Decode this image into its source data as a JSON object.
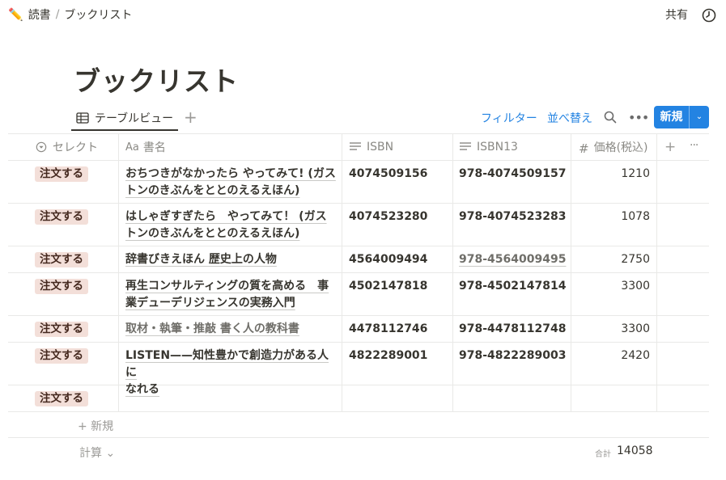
{
  "breadcrumb": {
    "icon": "pencil-icon",
    "parent": "読書",
    "separator": "/",
    "current": "ブックリスト"
  },
  "topbar": {
    "share_label": "共有",
    "history_icon": "clock-icon"
  },
  "page": {
    "title": "ブックリスト"
  },
  "view": {
    "tab_label": "テーブルビュー",
    "add_view_label": "+",
    "filter_label": "フィルター",
    "sort_label": "並べ替え",
    "new_label": "新規",
    "new_arrow": "⌄"
  },
  "columns": [
    {
      "label": "セレクト",
      "icon": "select-icon"
    },
    {
      "label": "書名",
      "icon": "title-aa-icon"
    },
    {
      "label": "ISBN",
      "icon": "text-lines-icon"
    },
    {
      "label": "ISBN13",
      "icon": "text-lines-icon"
    },
    {
      "label": "価格(税込)",
      "icon": "number-hash-icon"
    }
  ],
  "header_add": "+",
  "header_more": "···",
  "rows": [
    {
      "select": "注文する",
      "title": "おちつきがなかったら やってみて! (ガストンのきぶんをととのえるえほん)",
      "title_line1": "おちつきがなかったら やってみて! (ガス",
      "title_line2": "トンのきぶんをととのえるえほん)",
      "isbn": "4074509156",
      "isbn13": "978-4074509157",
      "price": "1210"
    },
    {
      "select": "注文する",
      "title": "はしゃぎすぎたら　やってみて！ (ガストンのきぶんをととのえるえほん)",
      "title_line1": "はしゃぎすぎたら　やってみて！ (ガス",
      "title_line2": "トンのきぶんをととのえるえほん)",
      "isbn": "4074523280",
      "isbn13": "978-4074523283",
      "price": "1078"
    },
    {
      "select": "注文する",
      "title": "辞書びきえほん 歴史上の人物",
      "title_line1": "辞書びきえほん 歴史上の人物",
      "title_line2": "",
      "isbn": "4564009494",
      "isbn13": "978-4564009495",
      "price": "2750"
    },
    {
      "select": "注文する",
      "title": "再生コンサルティングの質を高める　事業デューデリジェンスの実務入門",
      "title_line1": "再生コンサルティングの質を高める　事",
      "title_line2": "業デューデリジェンスの実務入門",
      "isbn": "4502147818",
      "isbn13": "978-4502147814",
      "price": "3300"
    },
    {
      "select": "注文する",
      "title": "取材・執筆・推敲 書く人の教科書",
      "title_line1": "取材・執筆・推敲 書く人の教科書",
      "title_line2": "",
      "isbn": "4478112746",
      "isbn13": "978-4478112748",
      "price": "3300"
    },
    {
      "select": "注文する",
      "title": "LISTEN——知性豊かで創造力がある人になれる",
      "title_line1": "LISTEN——知性豊かで創造力がある人に",
      "title_line2": "なれる",
      "isbn": "4822289001",
      "isbn13": "978-4822289003",
      "price": "2420"
    },
    {
      "select": "注文する",
      "title": "",
      "title_line1": "",
      "title_line2": "",
      "isbn": "",
      "isbn13": "",
      "price": ""
    }
  ],
  "footer": {
    "new_row_label": "+ 新規",
    "calc_label": "計算 ⌄",
    "total_label": "合計",
    "total_value": "14058"
  }
}
